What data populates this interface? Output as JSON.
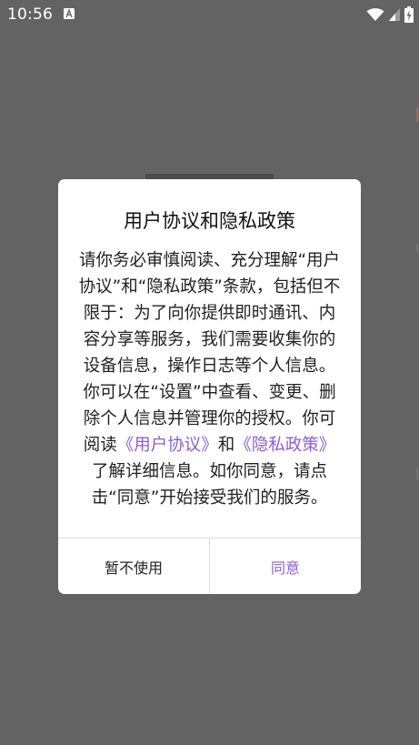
{
  "status_bar": {
    "time": "10:56",
    "notification_icon": "a-letter-icon",
    "right_icons": [
      "wifi-icon",
      "cell-signal-icon",
      "battery-charging-icon"
    ]
  },
  "dialog": {
    "title": "用户协议和隐私政策",
    "body_lines": [
      "请你务必审慎阅读、充分理解“用户",
      "协议”和“隐私政策”条款，包括但不",
      "限于：为了向你提供即时通讯、内",
      "容分享等服务，我们需要收集你的",
      "设备信息，操作日志等个人信息。",
      "你可以在“设置”中查看、变更、删",
      "除个人信息并管理你的授权。你可"
    ],
    "line8": {
      "prefix": "阅读",
      "user_agreement_link": "《用户协议》",
      "and": "和",
      "privacy_policy_link": "《隐私政策》"
    },
    "body_tail_lines": [
      "了解详细信息。如你同意，请点",
      "击“同意”开始接受我们的服务。"
    ],
    "decline_label": "暂不使用",
    "agree_label": "同意",
    "accent_color": "#8a5fd6"
  },
  "colors": {
    "scrim": "#636363",
    "dialog_bg": "#ffffff",
    "text": "#222222"
  }
}
